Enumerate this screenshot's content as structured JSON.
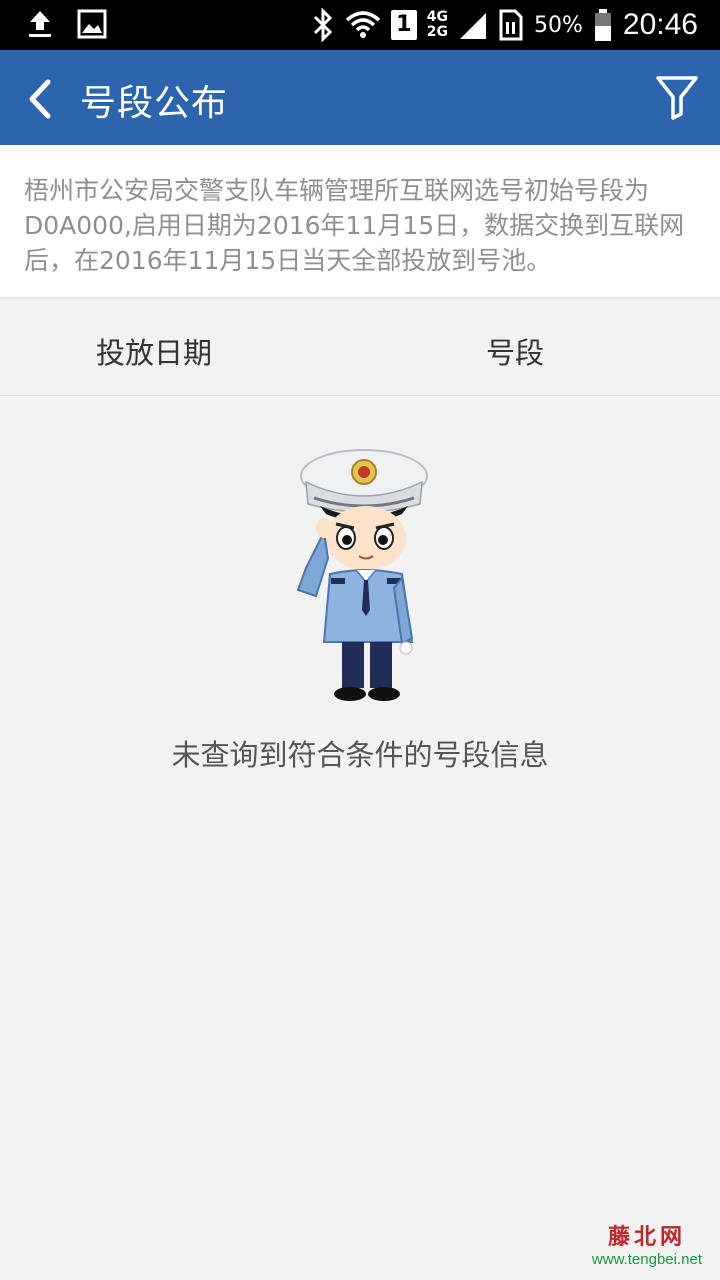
{
  "status_bar": {
    "sim_slot": "1",
    "net_type_top": "4G",
    "net_type_bottom": "2G",
    "battery": "50%",
    "time": "20:46",
    "icons": [
      "upload-icon",
      "image-icon",
      "bluetooth-icon",
      "wifi-icon",
      "sim-icon",
      "signal-icon",
      "sim-card-icon",
      "battery-icon"
    ]
  },
  "app_bar": {
    "title": "号段公布",
    "background": "#2c64ad"
  },
  "notice": {
    "text": "梧州市公安局交警支队车辆管理所互联网选号初始号段为D0A000,启用日期为2016年11月15日，数据交换到互联网后，在2016年11月15日当天全部投放到号池。"
  },
  "table": {
    "columns": [
      "投放日期",
      "号段"
    ]
  },
  "empty_state": {
    "message": "未查询到符合条件的号段信息"
  },
  "watermark": {
    "logo": "藤北网",
    "url": "www.tengbei.net"
  }
}
